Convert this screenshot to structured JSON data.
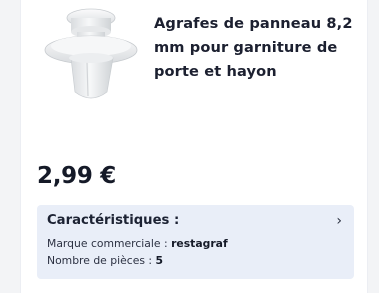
{
  "product": {
    "image_icon": "plastic-panel-clip-image",
    "title": "Agrafes de panneau 8,2 mm pour garniture de porte et hayon",
    "price": "2,99 €"
  },
  "features": {
    "heading": "Caractéristiques :",
    "chevron": "›",
    "rows": [
      {
        "label": "Marque commerciale : ",
        "value": "restagraf"
      },
      {
        "label": "Nombre de pièces : ",
        "value": "5"
      }
    ]
  }
}
